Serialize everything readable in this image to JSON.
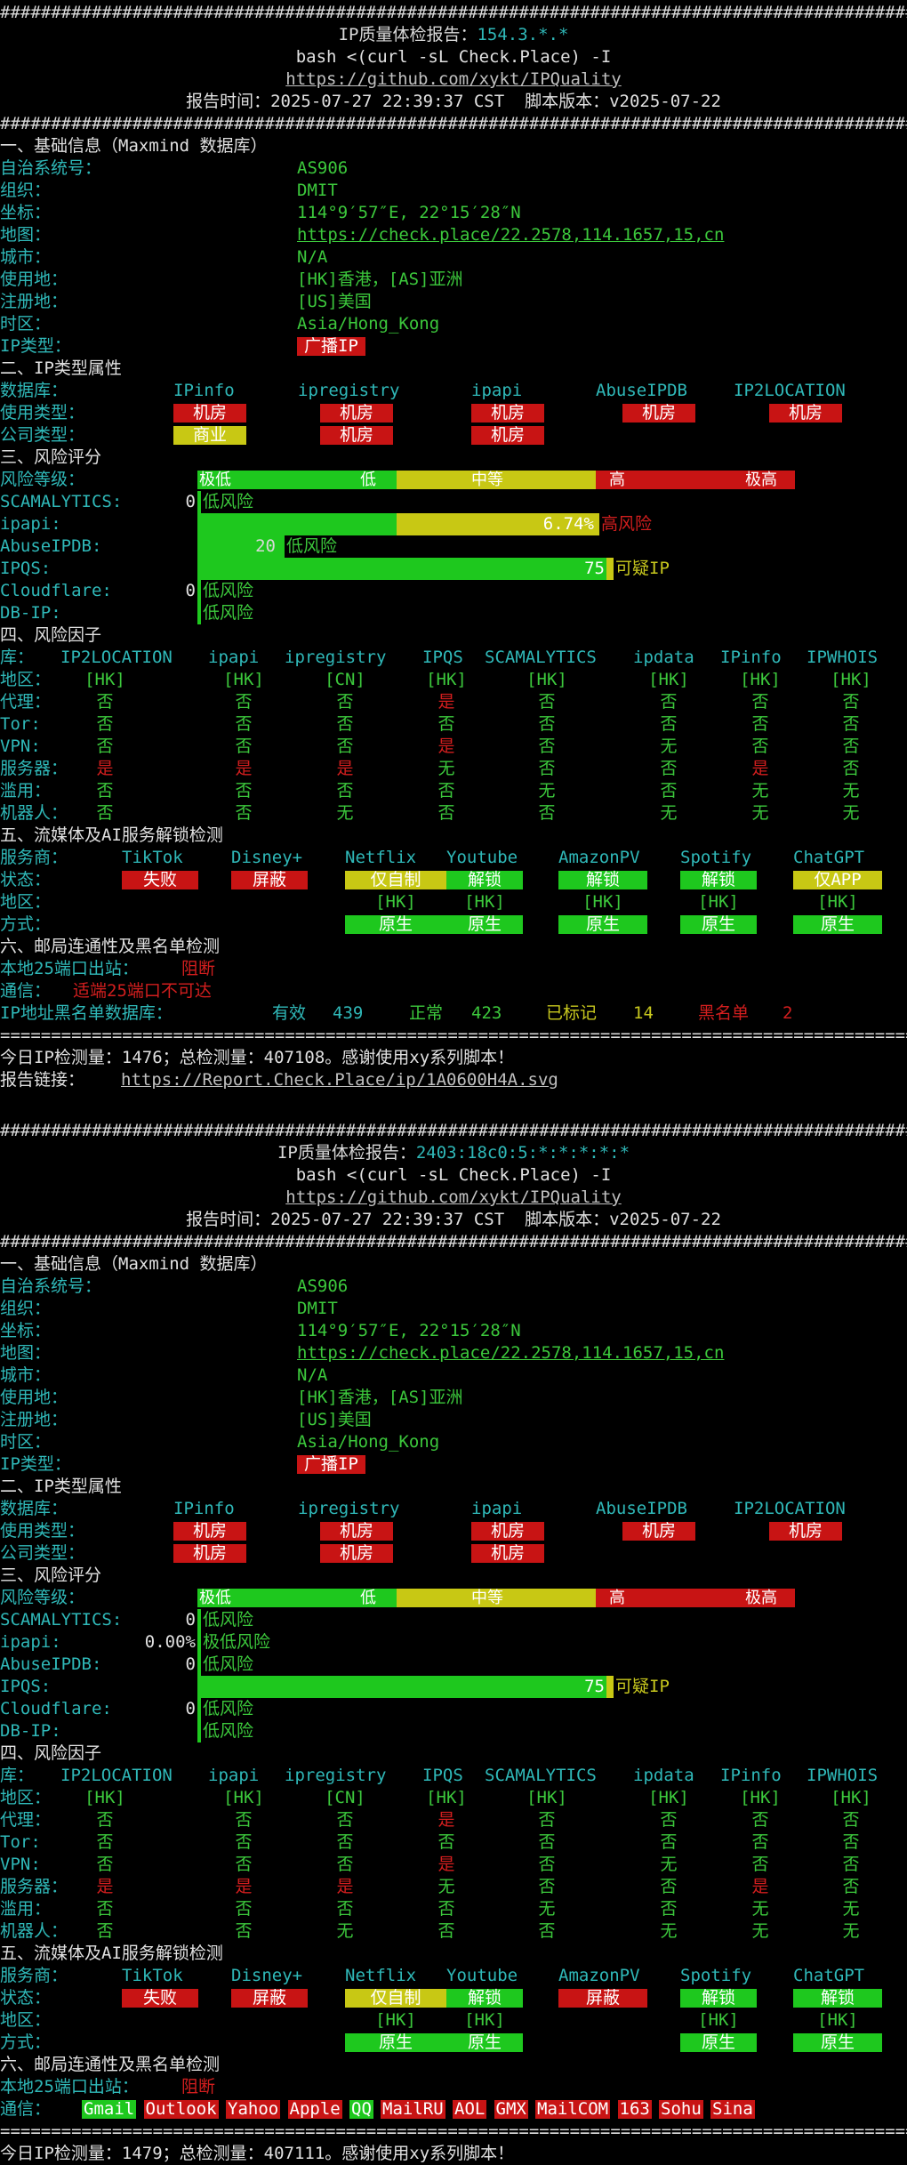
{
  "hashline": "##########################################################################################",
  "eqline": "==========================================================================================",
  "reports": [
    {
      "title_label": "IP质量体检报告：",
      "title_ip": "154.3.*.*",
      "cmd": "bash <(curl -sL Check.Place) -I",
      "url": "https://github.com/xykt/IPQuality",
      "time_line": "报告时间：2025-07-27 22:39:37 CST  脚本版本：v2025-07-22",
      "basic": {
        "title": "一、基础信息（Maxmind 数据库）",
        "rows": [
          [
            "自治系统号：",
            "AS906"
          ],
          [
            "组织：",
            "DMIT"
          ],
          [
            "坐标：",
            "114°9′57″E, 22°15′28″N"
          ],
          [
            "地图：",
            "https://check.place/22.2578,114.1657,15,cn"
          ],
          [
            "城市：",
            "N/A"
          ],
          [
            "使用地：",
            "[HK]香港，[AS]亚洲"
          ],
          [
            "注册地：",
            "[US]美国"
          ],
          [
            "时区：",
            "Asia/Hong_Kong"
          ],
          [
            "IP类型：",
            "广播IP"
          ]
        ]
      },
      "type": {
        "title": "二、IP类型属性",
        "label_db": "数据库：",
        "label_use": "使用类型：",
        "label_co": "公司类型：",
        "dbs": [
          "IPinfo",
          "ipregistry",
          "ipapi",
          "AbuseIPDB",
          "IP2LOCATION"
        ],
        "use": [
          "机房",
          "机房",
          "机房",
          "机房",
          "机房"
        ],
        "company": [
          "商业",
          "机房",
          "机房",
          "",
          ""
        ],
        "company_colors": [
          "y",
          "r",
          "r",
          "",
          ""
        ]
      },
      "risk": {
        "title": "三、风险评分",
        "level_label": "风险等级：",
        "levels": [
          "极低",
          "低",
          "中等",
          "高",
          "极高"
        ],
        "items": [
          {
            "name": "SCAMALYTICS:",
            "val": "0",
            "desc": "低风险",
            "fill": 0,
            "color": "g"
          },
          {
            "name": "ipapi:",
            "val": "6.74%",
            "desc": "高风险",
            "fill": 0,
            "color": "y",
            "wide": true
          },
          {
            "name": "AbuseIPDB:",
            "val": "20",
            "desc": "低风险",
            "fill": 20,
            "color": "g"
          },
          {
            "name": "IPQS:",
            "val": "75",
            "desc": "可疑IP",
            "fill": 75,
            "color": "y"
          },
          {
            "name": "Cloudflare:",
            "val": "0",
            "desc": "低风险",
            "fill": 0,
            "color": "g"
          },
          {
            "name": "DB-IP:",
            "val": "",
            "desc": "低风险",
            "fill": 0,
            "color": "g"
          }
        ]
      },
      "factors": {
        "title": "四、风险因子",
        "header": [
          "库：",
          "IP2LOCATION",
          "ipapi",
          "ipregistry",
          "IPQS",
          "SCAMALYTICS",
          "ipdata",
          "IPinfo",
          "IPWHOIS"
        ],
        "rows": [
          {
            "label": "地区：",
            "vals": [
              "[HK]",
              "[HK]",
              "[CN]",
              "[HK]",
              "[HK]",
              "[HK]",
              "[HK]",
              "[HK]"
            ],
            "cols": [
              "g",
              "g",
              "g",
              "g",
              "g",
              "g",
              "g",
              "g"
            ]
          },
          {
            "label": "代理：",
            "vals": [
              "否",
              "否",
              "否",
              "是",
              "否",
              "否",
              "否",
              "否"
            ],
            "cols": [
              "g",
              "g",
              "g",
              "r",
              "g",
              "g",
              "g",
              "g"
            ]
          },
          {
            "label": "Tor:",
            "vals": [
              "否",
              "否",
              "否",
              "否",
              "否",
              "否",
              "否",
              "否"
            ],
            "cols": [
              "g",
              "g",
              "g",
              "g",
              "g",
              "g",
              "g",
              "g"
            ]
          },
          {
            "label": "VPN:",
            "vals": [
              "否",
              "否",
              "否",
              "是",
              "否",
              "无",
              "否",
              "否"
            ],
            "cols": [
              "g",
              "g",
              "g",
              "r",
              "g",
              "g",
              "g",
              "g"
            ]
          },
          {
            "label": "服务器：",
            "vals": [
              "是",
              "是",
              "是",
              "无",
              "否",
              "否",
              "是",
              "否"
            ],
            "cols": [
              "r",
              "r",
              "r",
              "g",
              "g",
              "g",
              "r",
              "g"
            ]
          },
          {
            "label": "滥用：",
            "vals": [
              "否",
              "否",
              "否",
              "否",
              "无",
              "否",
              "无",
              "无"
            ],
            "cols": [
              "g",
              "g",
              "g",
              "g",
              "g",
              "g",
              "g",
              "g"
            ]
          },
          {
            "label": "机器人：",
            "vals": [
              "否",
              "否",
              "无",
              "否",
              "否",
              "无",
              "无",
              "无"
            ],
            "cols": [
              "g",
              "g",
              "g",
              "g",
              "g",
              "g",
              "g",
              "g"
            ]
          }
        ]
      },
      "stream": {
        "title": "五、流媒体及AI服务解锁检测",
        "header": [
          "服务商：",
          "TikTok",
          "Disney+",
          "Netflix",
          "Youtube",
          "AmazonPV",
          "Spotify",
          "ChatGPT"
        ],
        "status_label": "状态：",
        "status": [
          "失败",
          "屏蔽",
          "仅自制",
          "解锁",
          "解锁",
          "解锁",
          "仅APP"
        ],
        "status_bg": [
          "bR",
          "bR",
          "bY",
          "bG",
          "bG",
          "bG",
          "bY"
        ],
        "region_label": "地区：",
        "region": [
          "",
          "",
          "[HK]",
          "[HK]",
          "[HK]",
          "[HK]",
          "[HK]"
        ],
        "method_label": "方式：",
        "method": [
          "",
          "",
          "原生",
          "原生",
          "原生",
          "原生",
          "原生"
        ]
      },
      "mail": {
        "title": "六、邮局连通性及黑名单检测",
        "port_label": "本地25端口出站：",
        "port_val": "阻断",
        "comm_label": "通信：",
        "comm_text": "适端25端口不可达",
        "comm_tags": [],
        "bl_label": "IP地址黑名单数据库：",
        "bl_valid": "有效",
        "bl_valid_n": "439",
        "bl_ok": "正常",
        "bl_ok_n": "423",
        "bl_mark": "已标记",
        "bl_mark_n": "14",
        "bl_black": "黑名单",
        "bl_black_n": "2"
      },
      "footer": "今日IP检测量：1476；总检测量：407108。感谢使用xy系列脚本！",
      "link_label": "报告链接：",
      "link": "https://Report.Check.Place/ip/1A0600H4A.svg"
    },
    {
      "title_label": "IP质量体检报告：",
      "title_ip": "2403:18c0:5:*:*:*:*:*",
      "cmd": "bash <(curl -sL Check.Place) -I",
      "url": "https://github.com/xykt/IPQuality",
      "time_line": "报告时间：2025-07-27 22:39:37 CST  脚本版本：v2025-07-22",
      "basic": {
        "title": "一、基础信息（Maxmind 数据库）",
        "rows": [
          [
            "自治系统号：",
            "AS906"
          ],
          [
            "组织：",
            "DMIT"
          ],
          [
            "坐标：",
            "114°9′57″E, 22°15′28″N"
          ],
          [
            "地图：",
            "https://check.place/22.2578,114.1657,15,cn"
          ],
          [
            "城市：",
            "N/A"
          ],
          [
            "使用地：",
            "[HK]香港，[AS]亚洲"
          ],
          [
            "注册地：",
            "[US]美国"
          ],
          [
            "时区：",
            "Asia/Hong_Kong"
          ],
          [
            "IP类型：",
            "广播IP"
          ]
        ]
      },
      "type": {
        "title": "二、IP类型属性",
        "label_db": "数据库：",
        "label_use": "使用类型：",
        "label_co": "公司类型：",
        "dbs": [
          "IPinfo",
          "ipregistry",
          "ipapi",
          "AbuseIPDB",
          "IP2LOCATION"
        ],
        "use": [
          "机房",
          "机房",
          "机房",
          "机房",
          "机房"
        ],
        "company": [
          "机房",
          "机房",
          "机房",
          "",
          ""
        ],
        "company_colors": [
          "r",
          "r",
          "r",
          "",
          ""
        ]
      },
      "risk": {
        "title": "三、风险评分",
        "level_label": "风险等级：",
        "levels": [
          "极低",
          "低",
          "中等",
          "高",
          "极高"
        ],
        "items": [
          {
            "name": "SCAMALYTICS:",
            "val": "0",
            "desc": "低风险",
            "fill": 0,
            "color": "g"
          },
          {
            "name": "ipapi:",
            "val": "0.00%",
            "desc": "极低风险",
            "fill": 0,
            "color": "g"
          },
          {
            "name": "AbuseIPDB:",
            "val": "0",
            "desc": "低风险",
            "fill": 0,
            "color": "g"
          },
          {
            "name": "IPQS:",
            "val": "75",
            "desc": "可疑IP",
            "fill": 75,
            "color": "y"
          },
          {
            "name": "Cloudflare:",
            "val": "0",
            "desc": "低风险",
            "fill": 0,
            "color": "g"
          },
          {
            "name": "DB-IP:",
            "val": "",
            "desc": "低风险",
            "fill": 0,
            "color": "g"
          }
        ]
      },
      "factors": {
        "title": "四、风险因子",
        "header": [
          "库：",
          "IP2LOCATION",
          "ipapi",
          "ipregistry",
          "IPQS",
          "SCAMALYTICS",
          "ipdata",
          "IPinfo",
          "IPWHOIS"
        ],
        "rows": [
          {
            "label": "地区：",
            "vals": [
              "[HK]",
              "[HK]",
              "[CN]",
              "[HK]",
              "[HK]",
              "[HK]",
              "[HK]",
              "[HK]"
            ],
            "cols": [
              "g",
              "g",
              "g",
              "g",
              "g",
              "g",
              "g",
              "g"
            ]
          },
          {
            "label": "代理：",
            "vals": [
              "否",
              "否",
              "否",
              "是",
              "否",
              "否",
              "否",
              "否"
            ],
            "cols": [
              "g",
              "g",
              "g",
              "r",
              "g",
              "g",
              "g",
              "g"
            ]
          },
          {
            "label": "Tor:",
            "vals": [
              "否",
              "否",
              "否",
              "否",
              "否",
              "否",
              "否",
              "否"
            ],
            "cols": [
              "g",
              "g",
              "g",
              "g",
              "g",
              "g",
              "g",
              "g"
            ]
          },
          {
            "label": "VPN:",
            "vals": [
              "否",
              "否",
              "否",
              "是",
              "否",
              "无",
              "否",
              "否"
            ],
            "cols": [
              "g",
              "g",
              "g",
              "r",
              "g",
              "g",
              "g",
              "g"
            ]
          },
          {
            "label": "服务器：",
            "vals": [
              "是",
              "是",
              "是",
              "无",
              "否",
              "否",
              "是",
              "否"
            ],
            "cols": [
              "r",
              "r",
              "r",
              "g",
              "g",
              "g",
              "r",
              "g"
            ]
          },
          {
            "label": "滥用：",
            "vals": [
              "否",
              "否",
              "否",
              "否",
              "无",
              "否",
              "无",
              "无"
            ],
            "cols": [
              "g",
              "g",
              "g",
              "g",
              "g",
              "g",
              "g",
              "g"
            ]
          },
          {
            "label": "机器人：",
            "vals": [
              "否",
              "否",
              "无",
              "否",
              "否",
              "无",
              "无",
              "无"
            ],
            "cols": [
              "g",
              "g",
              "g",
              "g",
              "g",
              "g",
              "g",
              "g"
            ]
          }
        ]
      },
      "stream": {
        "title": "五、流媒体及AI服务解锁检测",
        "header": [
          "服务商：",
          "TikTok",
          "Disney+",
          "Netflix",
          "Youtube",
          "AmazonPV",
          "Spotify",
          "ChatGPT"
        ],
        "status_label": "状态：",
        "status": [
          "失败",
          "屏蔽",
          "仅自制",
          "解锁",
          "屏蔽",
          "解锁",
          "解锁"
        ],
        "status_bg": [
          "bR",
          "bR",
          "bY",
          "bG",
          "bR",
          "bG",
          "bG"
        ],
        "region_label": "地区：",
        "region": [
          "",
          "",
          "[HK]",
          "[HK]",
          "",
          "[HK]",
          "[HK]"
        ],
        "method_label": "方式：",
        "method": [
          "",
          "",
          "原生",
          "原生",
          "",
          "原生",
          "原生"
        ]
      },
      "mail": {
        "title": "六、邮局连通性及黑名单检测",
        "port_label": "本地25端口出站：",
        "port_val": "阻断",
        "comm_label": "通信：",
        "comm_text": "",
        "comm_tags": [
          {
            "t": "Gmail",
            "c": "bG"
          },
          {
            "t": "Outlook",
            "c": "bR"
          },
          {
            "t": "Yahoo",
            "c": "bR"
          },
          {
            "t": "Apple",
            "c": "bR"
          },
          {
            "t": "QQ",
            "c": "bG"
          },
          {
            "t": "MailRU",
            "c": "bR"
          },
          {
            "t": "AOL",
            "c": "bR"
          },
          {
            "t": "GMX",
            "c": "bR"
          },
          {
            "t": "MailCOM",
            "c": "bR"
          },
          {
            "t": "163",
            "c": "bR"
          },
          {
            "t": "Sohu",
            "c": "bR"
          },
          {
            "t": "Sina",
            "c": "bR"
          }
        ],
        "bl_label": "",
        "bl_valid": "",
        "bl_valid_n": "",
        "bl_ok": "",
        "bl_ok_n": "",
        "bl_mark": "",
        "bl_mark_n": "",
        "bl_black": "",
        "bl_black_n": ""
      },
      "footer": "今日IP检测量：1479；总检测量：407111。感谢使用xy系列脚本！",
      "link_label": "",
      "link": ""
    }
  ]
}
